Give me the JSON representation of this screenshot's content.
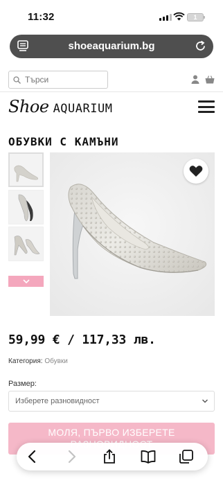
{
  "status_bar": {
    "time": "11:32",
    "battery": "1"
  },
  "browser": {
    "url": "shoeaquarium.bg"
  },
  "search": {
    "placeholder": "Търси"
  },
  "header": {
    "logo_script": "Shoe",
    "logo_caps": "AQUARIUM"
  },
  "product": {
    "title": "ОБУВКИ С КАМЪНИ",
    "price": "59,99 € / 117,33 лв.",
    "category_label": "Категория:",
    "category_value": "Обувки",
    "size_label": "Размер:",
    "size_placeholder": "Изберете разновидност",
    "cta_label": "МОЛЯ, ПЪРВО ИЗБЕРЕТЕ РАЗНОВИДНОСТ"
  },
  "colors": {
    "accent_pink": "#f4a7bd",
    "cta_pink": "#f5b8c8",
    "urlbar": "#4f4f4f"
  }
}
